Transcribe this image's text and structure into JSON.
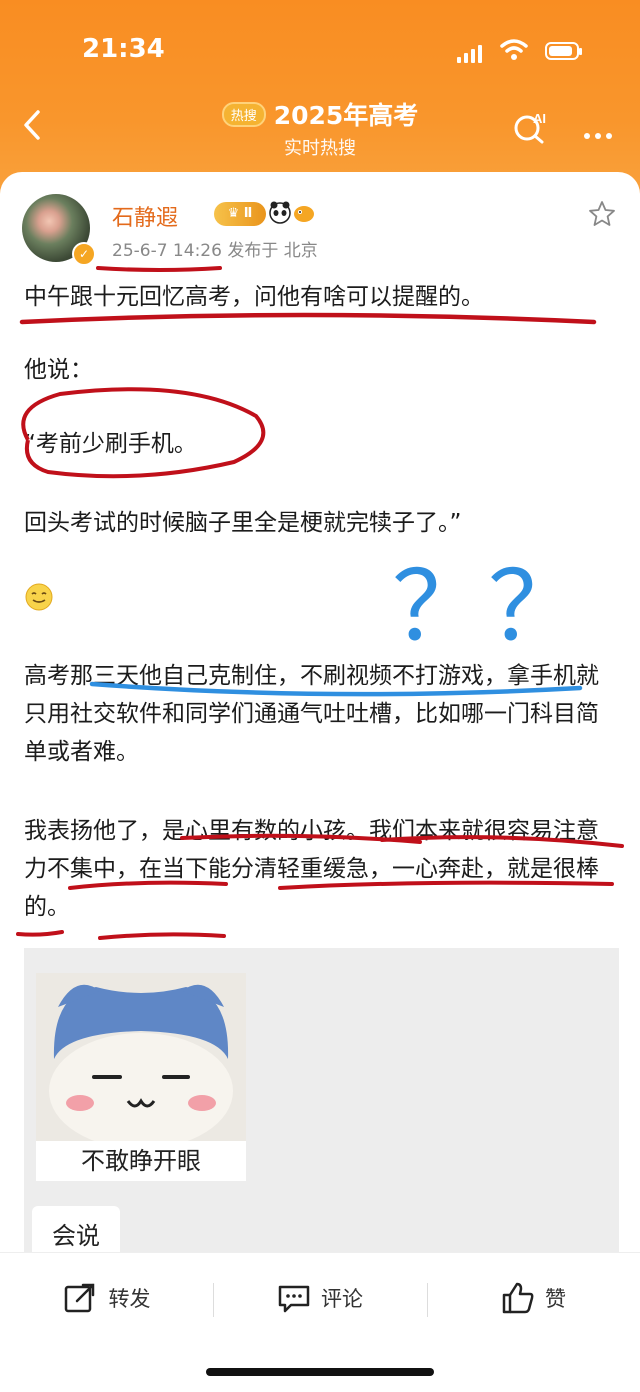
{
  "status_bar": {
    "time": "21:34",
    "battery_level": 0.9
  },
  "nav": {
    "badge": "热搜",
    "title": "2025年高考",
    "subtitle": "实时热搜",
    "ai_label": "AI"
  },
  "post": {
    "author": "石静遐",
    "vip_level": "Ⅱ",
    "meta": "25-6-7 14:26  发布于 北京",
    "paragraphs": [
      "中午跟十元回忆高考，问他有啥可以提醒的。",
      "他说：",
      "“考前少刷手机。",
      "回头考试的时候脑子里全是梗就完犊子了。”",
      "高考那三天他自己克制住，不刷视频不打游戏，拿手机就只用社交软件和同学们通通气吐吐槽，比如哪一门科目简单或者难。",
      "我表扬他了，是心里有数的小孩。我们本来就很容易注意力不集中，在当下能分清轻重缓急，一心奔赴，就是很棒的。"
    ],
    "annotation": "？？",
    "sticker_caption": "不敢睁开眼",
    "comment_chip": "会说"
  },
  "actions": {
    "repost": "转发",
    "comment": "评论",
    "like": "赞"
  },
  "colors": {
    "header": "#f98d22",
    "username": "#e36a1b",
    "red_ink": "#c0101a",
    "blue_ink": "#2f8fe0"
  }
}
